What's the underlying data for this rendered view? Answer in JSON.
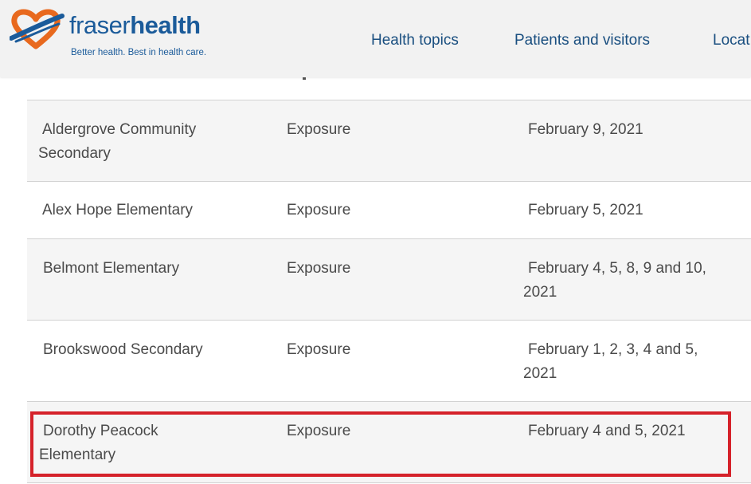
{
  "header": {
    "brand_light": "fraser",
    "brand_bold": "health",
    "tagline": "Better health. Best in health care.",
    "nav": [
      "Health topics",
      "Patients and visitors",
      "Locat"
    ]
  },
  "colors": {
    "brand_blue": "#1b5b9a",
    "logo_orange": "#e8691e",
    "highlight_red": "#d5222a",
    "row_shade": "#f5f5f5"
  },
  "table": {
    "rows": [
      {
        "name_line1": "Aldergrove Community",
        "name_line2": "Secondary",
        "type": "Exposure",
        "date_line1": "February 9, 2021",
        "date_line2": ""
      },
      {
        "name_line1": "Alex Hope Elementary",
        "name_line2": "",
        "type": "Exposure",
        "date_line1": "February 5, 2021",
        "date_line2": ""
      },
      {
        "name_line1": "Belmont Elementary",
        "name_line2": "",
        "type": "Exposure",
        "date_line1": "February 4, 5, 8, 9 and 10,",
        "date_line2": "2021"
      },
      {
        "name_line1": "Brookswood Secondary",
        "name_line2": "",
        "type": "Exposure",
        "date_line1": "February 1, 2, 3, 4 and 5,",
        "date_line2": "2021"
      },
      {
        "name_line1": "Dorothy Peacock",
        "name_line2": "Elementary",
        "type": "Exposure",
        "date_line1": "February 4 and 5, 2021",
        "date_line2": ""
      }
    ]
  }
}
